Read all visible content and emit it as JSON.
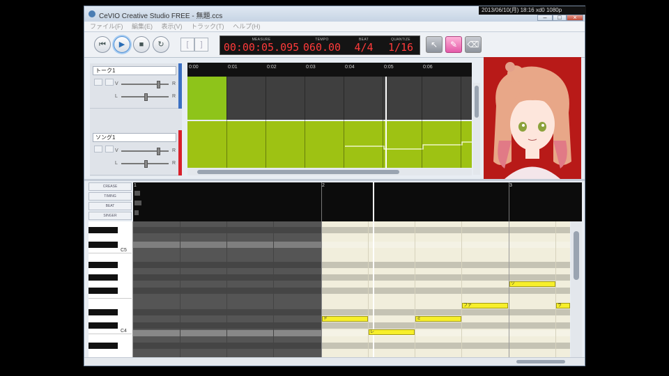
{
  "window": {
    "title": "CeVIO Creative Studio FREE - 無題.ccs",
    "clock": "2013/06/10(月) 18:16 xd0 1080p"
  },
  "menu": [
    "ファイル(F)",
    "編集(E)",
    "表示(V)",
    "トラック(T)",
    "ヘルプ(H)"
  ],
  "transport": {
    "labels": {
      "measure": "MEASURE",
      "tempo": "TEMPO",
      "beat": "BEAT",
      "quantize": "QUANTIZE"
    },
    "time": "00:00:05.095",
    "tempo": "060.00",
    "beat": "4/4",
    "quantize": "1/16"
  },
  "tracks": [
    {
      "name": "トーク1",
      "type": "talk",
      "color": "#3b6fc2"
    },
    {
      "name": "ソング1",
      "type": "song",
      "color": "#d8202a"
    }
  ],
  "mixer_labels": {
    "volume": "V",
    "pan": "L",
    "right": "R"
  },
  "arranger": {
    "ticks": [
      "0:00",
      "0:01",
      "0:02",
      "0:03",
      "0:04",
      "0:05",
      "0:06"
    ],
    "talk_color": "#3f3f3f",
    "song_color": "#9ec213"
  },
  "piano_roll": {
    "param_labels": [
      "CREASE",
      "TIMING",
      "BEAT",
      "SINGER"
    ],
    "measures": [
      "1",
      "2",
      "3"
    ],
    "key_labels": [
      "C5",
      "C4"
    ],
    "notes": [
      {
        "lyric": "ド",
        "pitch": "E4",
        "beat": 0,
        "length": 1
      },
      {
        "lyric": "レ",
        "pitch": "D4",
        "beat": 1,
        "length": 1
      },
      {
        "lyric": "ミ",
        "pitch": "E4",
        "beat": 2,
        "length": 1
      },
      {
        "lyric": "ファ",
        "pitch": "F4",
        "beat": 3,
        "length": 1
      },
      {
        "lyric": "ソ",
        "pitch": "A4",
        "beat": 4,
        "length": 1
      },
      {
        "lyric": "ラ",
        "pitch": "F4",
        "beat": 5,
        "length": 1
      }
    ]
  },
  "icons": {
    "rewind": "rewind-icon",
    "play": "play-icon",
    "stop": "stop-icon",
    "loop": "loop-icon",
    "arrow": "pointer-tool-icon",
    "pencil": "pencil-tool-icon",
    "eraser": "eraser-tool-icon"
  }
}
